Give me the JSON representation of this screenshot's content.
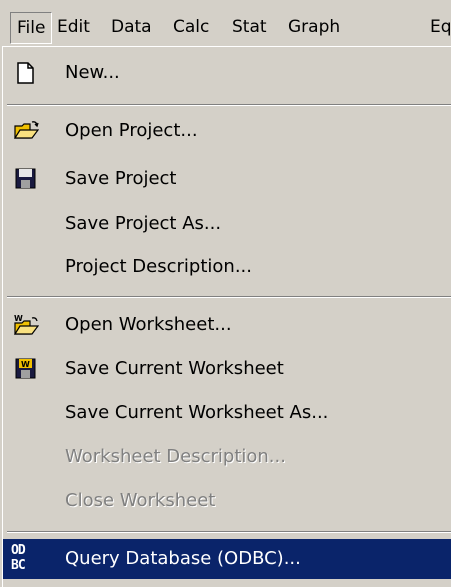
{
  "menubar": {
    "file": "File",
    "edit": "Edit",
    "data": "Data",
    "calc": "Calc",
    "stat": "Stat",
    "graph": "Graph",
    "eq": "Eq"
  },
  "file_menu": {
    "new": "New...",
    "open_project": "Open Project...",
    "save_project": "Save Project",
    "save_project_as": "Save Project As...",
    "project_description": "Project Description...",
    "open_worksheet": "Open Worksheet...",
    "save_current_worksheet": "Save Current Worksheet",
    "save_current_worksheet_as": "Save Current Worksheet As...",
    "worksheet_description": "Worksheet Description...",
    "close_worksheet": "Close Worksheet",
    "query_database": "Query Database (ODBC)...",
    "odbc_icon_text": "ODBC"
  },
  "colors": {
    "menu_bg": "#d4d0c8",
    "highlight_bg": "#0a246a",
    "disabled_text": "#808080",
    "save_icon_yellow": "#f0c000"
  }
}
